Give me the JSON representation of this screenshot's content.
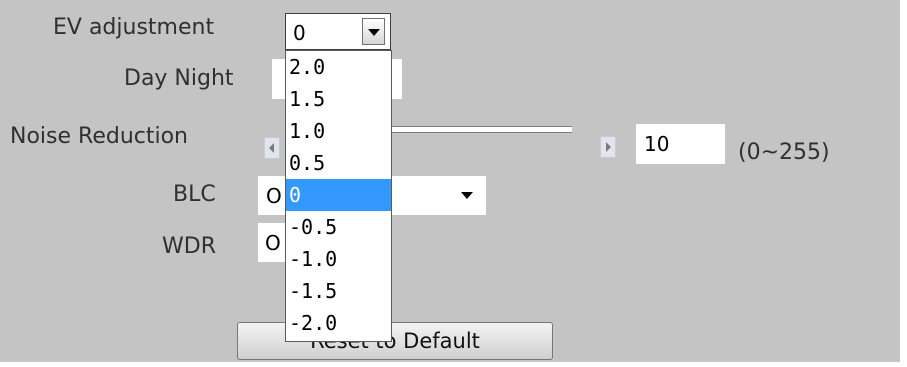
{
  "labels": {
    "ev": "EV adjustment",
    "day_night": "Day Night",
    "noise_reduction": "Noise Reduction",
    "blc": "BLC",
    "wdr": "WDR"
  },
  "ev_select": {
    "value": "0",
    "options": [
      "2.0",
      "1.5",
      "1.0",
      "0.5",
      "0",
      "-0.5",
      "-1.0",
      "-1.5",
      "-2.0"
    ],
    "selected_index": 4
  },
  "noise_reduction": {
    "value": "10",
    "range": "(0~255)"
  },
  "blc": {
    "value": "O"
  },
  "wdr": {
    "value": "O"
  },
  "reset_button": {
    "label": "Reset to Default"
  },
  "colors": {
    "panel_background": "#c4c4c4",
    "selection_highlight": "#3399ff"
  },
  "icons": {
    "ev_dropdown_arrow": "chevron-down-icon",
    "slider_left": "arrow-left-icon",
    "slider_right": "arrow-right-icon",
    "blc_dropdown_arrow": "chevron-down-icon"
  }
}
